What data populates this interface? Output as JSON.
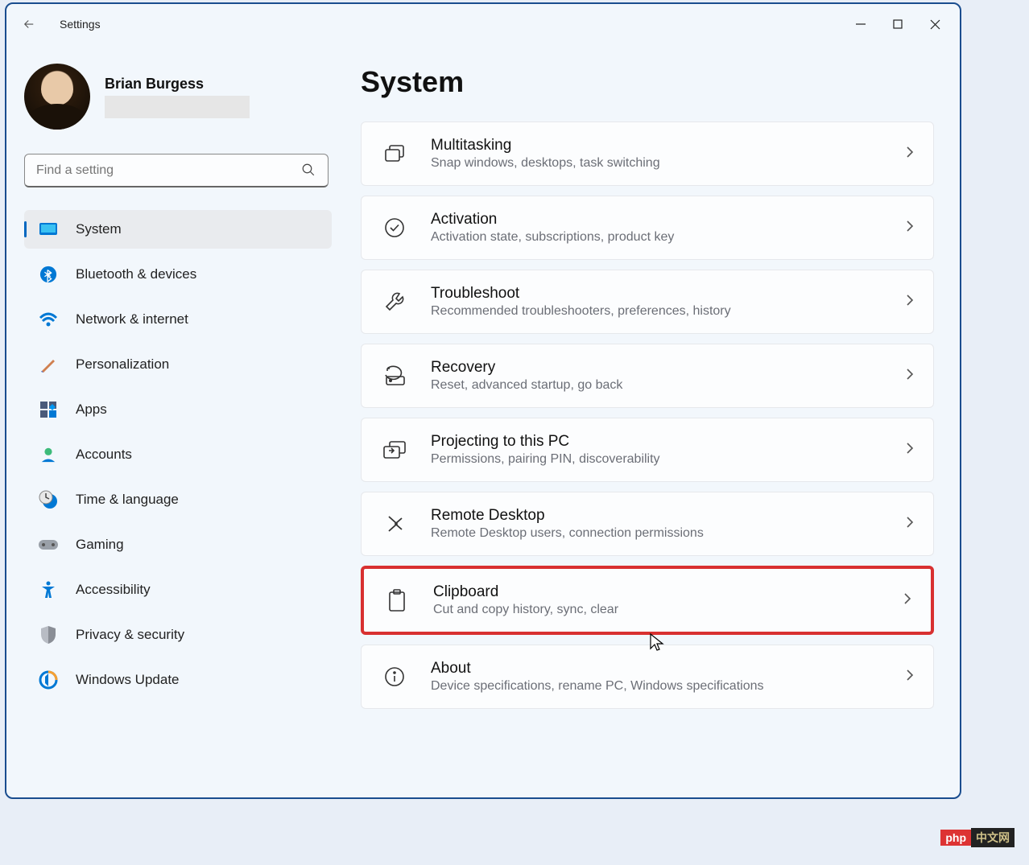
{
  "app": {
    "name": "Settings"
  },
  "user": {
    "name": "Brian Burgess"
  },
  "search": {
    "placeholder": "Find a setting"
  },
  "sidebar": {
    "items": [
      {
        "label": "System",
        "icon": "monitor-icon",
        "selected": true
      },
      {
        "label": "Bluetooth & devices",
        "icon": "bluetooth-icon",
        "selected": false
      },
      {
        "label": "Network & internet",
        "icon": "wifi-icon",
        "selected": false
      },
      {
        "label": "Personalization",
        "icon": "brush-icon",
        "selected": false
      },
      {
        "label": "Apps",
        "icon": "apps-icon",
        "selected": false
      },
      {
        "label": "Accounts",
        "icon": "person-icon",
        "selected": false
      },
      {
        "label": "Time & language",
        "icon": "clock-globe-icon",
        "selected": false
      },
      {
        "label": "Gaming",
        "icon": "gamepad-icon",
        "selected": false
      },
      {
        "label": "Accessibility",
        "icon": "accessibility-icon",
        "selected": false
      },
      {
        "label": "Privacy & security",
        "icon": "shield-icon",
        "selected": false
      },
      {
        "label": "Windows Update",
        "icon": "update-icon",
        "selected": false
      }
    ]
  },
  "page": {
    "title": "System"
  },
  "settings": [
    {
      "title": "Multitasking",
      "subtitle": "Snap windows, desktops, task switching",
      "icon": "multitask-icon",
      "highlighted": false
    },
    {
      "title": "Activation",
      "subtitle": "Activation state, subscriptions, product key",
      "icon": "check-circle-icon",
      "highlighted": false
    },
    {
      "title": "Troubleshoot",
      "subtitle": "Recommended troubleshooters, preferences, history",
      "icon": "wrench-icon",
      "highlighted": false
    },
    {
      "title": "Recovery",
      "subtitle": "Reset, advanced startup, go back",
      "icon": "recovery-icon",
      "highlighted": false
    },
    {
      "title": "Projecting to this PC",
      "subtitle": "Permissions, pairing PIN, discoverability",
      "icon": "project-icon",
      "highlighted": false
    },
    {
      "title": "Remote Desktop",
      "subtitle": "Remote Desktop users, connection permissions",
      "icon": "remote-icon",
      "highlighted": false
    },
    {
      "title": "Clipboard",
      "subtitle": "Cut and copy history, sync, clear",
      "icon": "clipboard-icon",
      "highlighted": true
    },
    {
      "title": "About",
      "subtitle": "Device specifications, rename PC, Windows specifications",
      "icon": "info-icon",
      "highlighted": false
    }
  ],
  "watermark": {
    "left": "php",
    "right": "中文网"
  }
}
